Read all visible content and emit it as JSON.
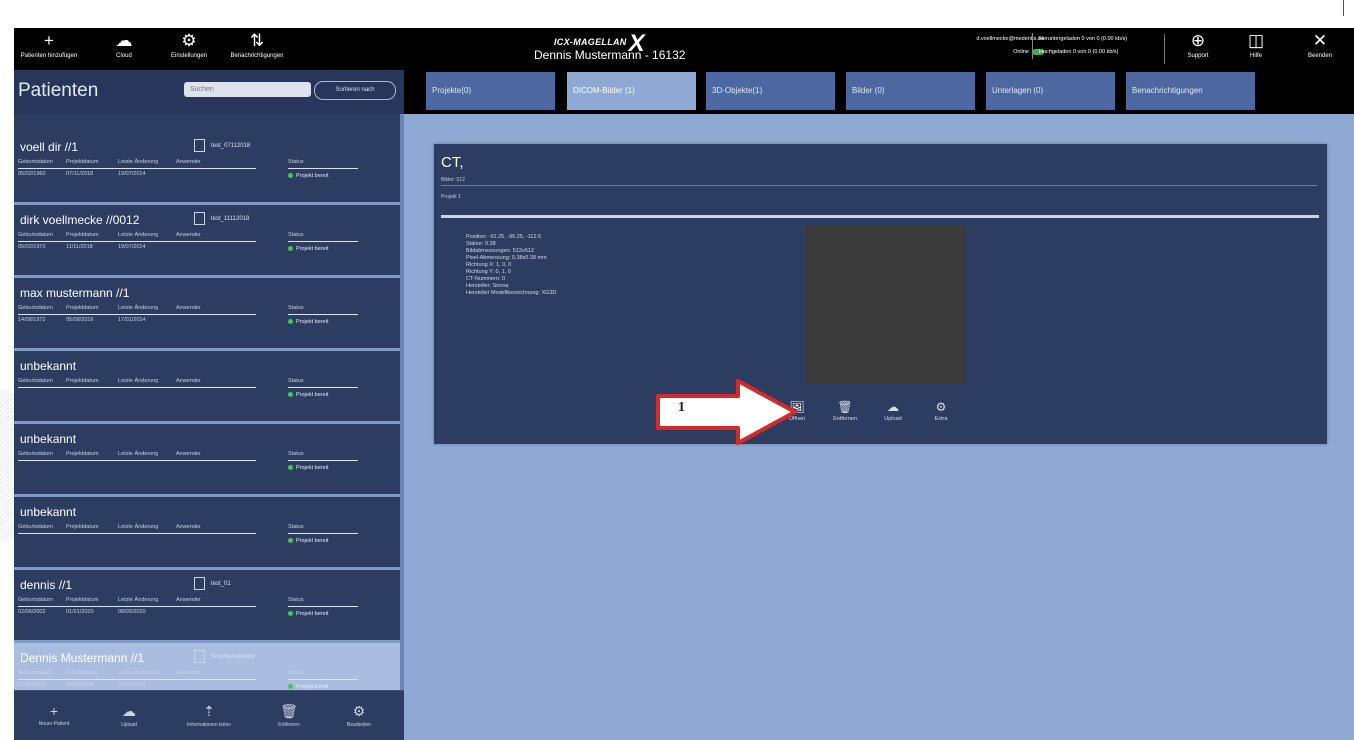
{
  "topbar": {
    "buttons": [
      {
        "icon": "plus-icon",
        "glyph": "+",
        "label": "Patienten hinzufügen"
      },
      {
        "icon": "cloud-icon",
        "glyph": "☁",
        "label": "Cloud"
      },
      {
        "icon": "gear-icon",
        "glyph": "⚙",
        "label": "Einstellungen"
      },
      {
        "icon": "sort-icon",
        "glyph": "⇅",
        "label": "Benachrichtigungen"
      }
    ],
    "logo_text": "ICX-MAGELLAN",
    "logo_mark": "X",
    "user": "Dennis Mustermann - 16132",
    "email": "d.voellmecke@medentis.de",
    "online_label": "Online",
    "upload_status": "Hochgeladen 0 von 0 (0.00 kb/s)",
    "download_status": "Heruntergeladen 0 von 0 (0.00 kb/s)",
    "right_buttons": [
      {
        "icon": "globe-icon",
        "glyph": "⊕",
        "label": "Support"
      },
      {
        "icon": "book-icon",
        "glyph": "◫",
        "label": "Hilfe"
      },
      {
        "icon": "close-icon",
        "glyph": "✕",
        "label": "Beenden"
      }
    ]
  },
  "sidebar": {
    "title": "Patienten",
    "search_placeholder": "Suchen",
    "sort_label": "Sortieren nach",
    "column_labels": {
      "birth": "Geburtsdatum",
      "project": "Projektdatum",
      "change": "Letzte Änderung",
      "user": "Anwender",
      "status": "Status"
    },
    "patients": [
      {
        "name": "voell dir //1",
        "doc": "test_07112018",
        "birth": "05/02/1960",
        "project": "07/11/2018",
        "change": "19/07/2014",
        "status": "Projekt bereit"
      },
      {
        "name": "dirk voellmecke //0012",
        "doc": "test_11112018",
        "birth": "05/02/1970",
        "project": "11/11/2018",
        "change": "19/07/2014",
        "status": "Projekt bereit"
      },
      {
        "name": "max mustermann //1",
        "doc": "",
        "birth": "14/08/1972",
        "project": "05/08/2016",
        "change": "17/01/2014",
        "status": "Projekt bereit"
      },
      {
        "name": "unbekannt",
        "doc": "",
        "birth": "",
        "project": "",
        "change": "",
        "status": "Projekt bereit"
      },
      {
        "name": "unbekannt",
        "doc": "",
        "birth": "",
        "project": "",
        "change": "",
        "status": "Projekt bereit"
      },
      {
        "name": "unbekannt",
        "doc": "",
        "birth": "",
        "project": "",
        "change": "",
        "status": "Projekt bereit"
      },
      {
        "name": "dennis //1",
        "doc": "test_01",
        "birth": "02/06/2002",
        "project": "01/01/2020",
        "change": "08/05/2020",
        "status": "Projekt bereit"
      },
      {
        "name": "Dennis Mustermann //1",
        "doc": "Knochenstruktur",
        "birth": "02/06/2002",
        "project": "06/04/2020",
        "change": "17/01/2014",
        "status": "Projekt bereit"
      }
    ],
    "footer": [
      {
        "icon": "plus-icon",
        "glyph": "+",
        "label": "Neuer Patient"
      },
      {
        "icon": "cloud-icon",
        "glyph": "☁",
        "label": "Upload"
      },
      {
        "icon": "upload-icon",
        "glyph": "⇡",
        "label": "Informationen teilen"
      },
      {
        "icon": "trash-icon",
        "glyph": "🗑",
        "label": "Entfernen"
      },
      {
        "icon": "gear-icon",
        "glyph": "⚙",
        "label": "Bearbeiten"
      }
    ]
  },
  "tabs": [
    {
      "label": "Projekte(0)"
    },
    {
      "label": "DICOM-Bilder (1)"
    },
    {
      "label": "3D-Objekte(1)"
    },
    {
      "label": "Bilder (0)"
    },
    {
      "label": "Unterlagen (0)"
    },
    {
      "label": "Benachrichtigungen"
    }
  ],
  "card": {
    "title": "CT,",
    "sub1": "Bilder: 512",
    "sub2": "Projekt 1",
    "metadata": [
      "Position: -91.25, -96.25, -112.5",
      "Stärke: 0.38",
      "Bildabmessungen: 512x512",
      "Pixel-Abmessung: 0.38x0.38 mm",
      "Richtung X: 1, 0, 0",
      "Richtung Y: 0, 1, 0",
      "CT-Nummern: 0",
      "Hersteller: Sirona",
      "Hersteller Modellbezeichnung: XG3D"
    ],
    "actions": [
      {
        "icon": "image-icon",
        "glyph": "🖼",
        "label": "Öffnen"
      },
      {
        "icon": "trash-icon",
        "glyph": "🗑",
        "label": "Entfernen"
      },
      {
        "icon": "cloud-icon",
        "glyph": "☁",
        "label": "Upload"
      },
      {
        "icon": "gear-icon",
        "glyph": "⚙",
        "label": "Extra"
      }
    ]
  },
  "annotation": {
    "number": "1",
    "color": "#d32a2a"
  }
}
